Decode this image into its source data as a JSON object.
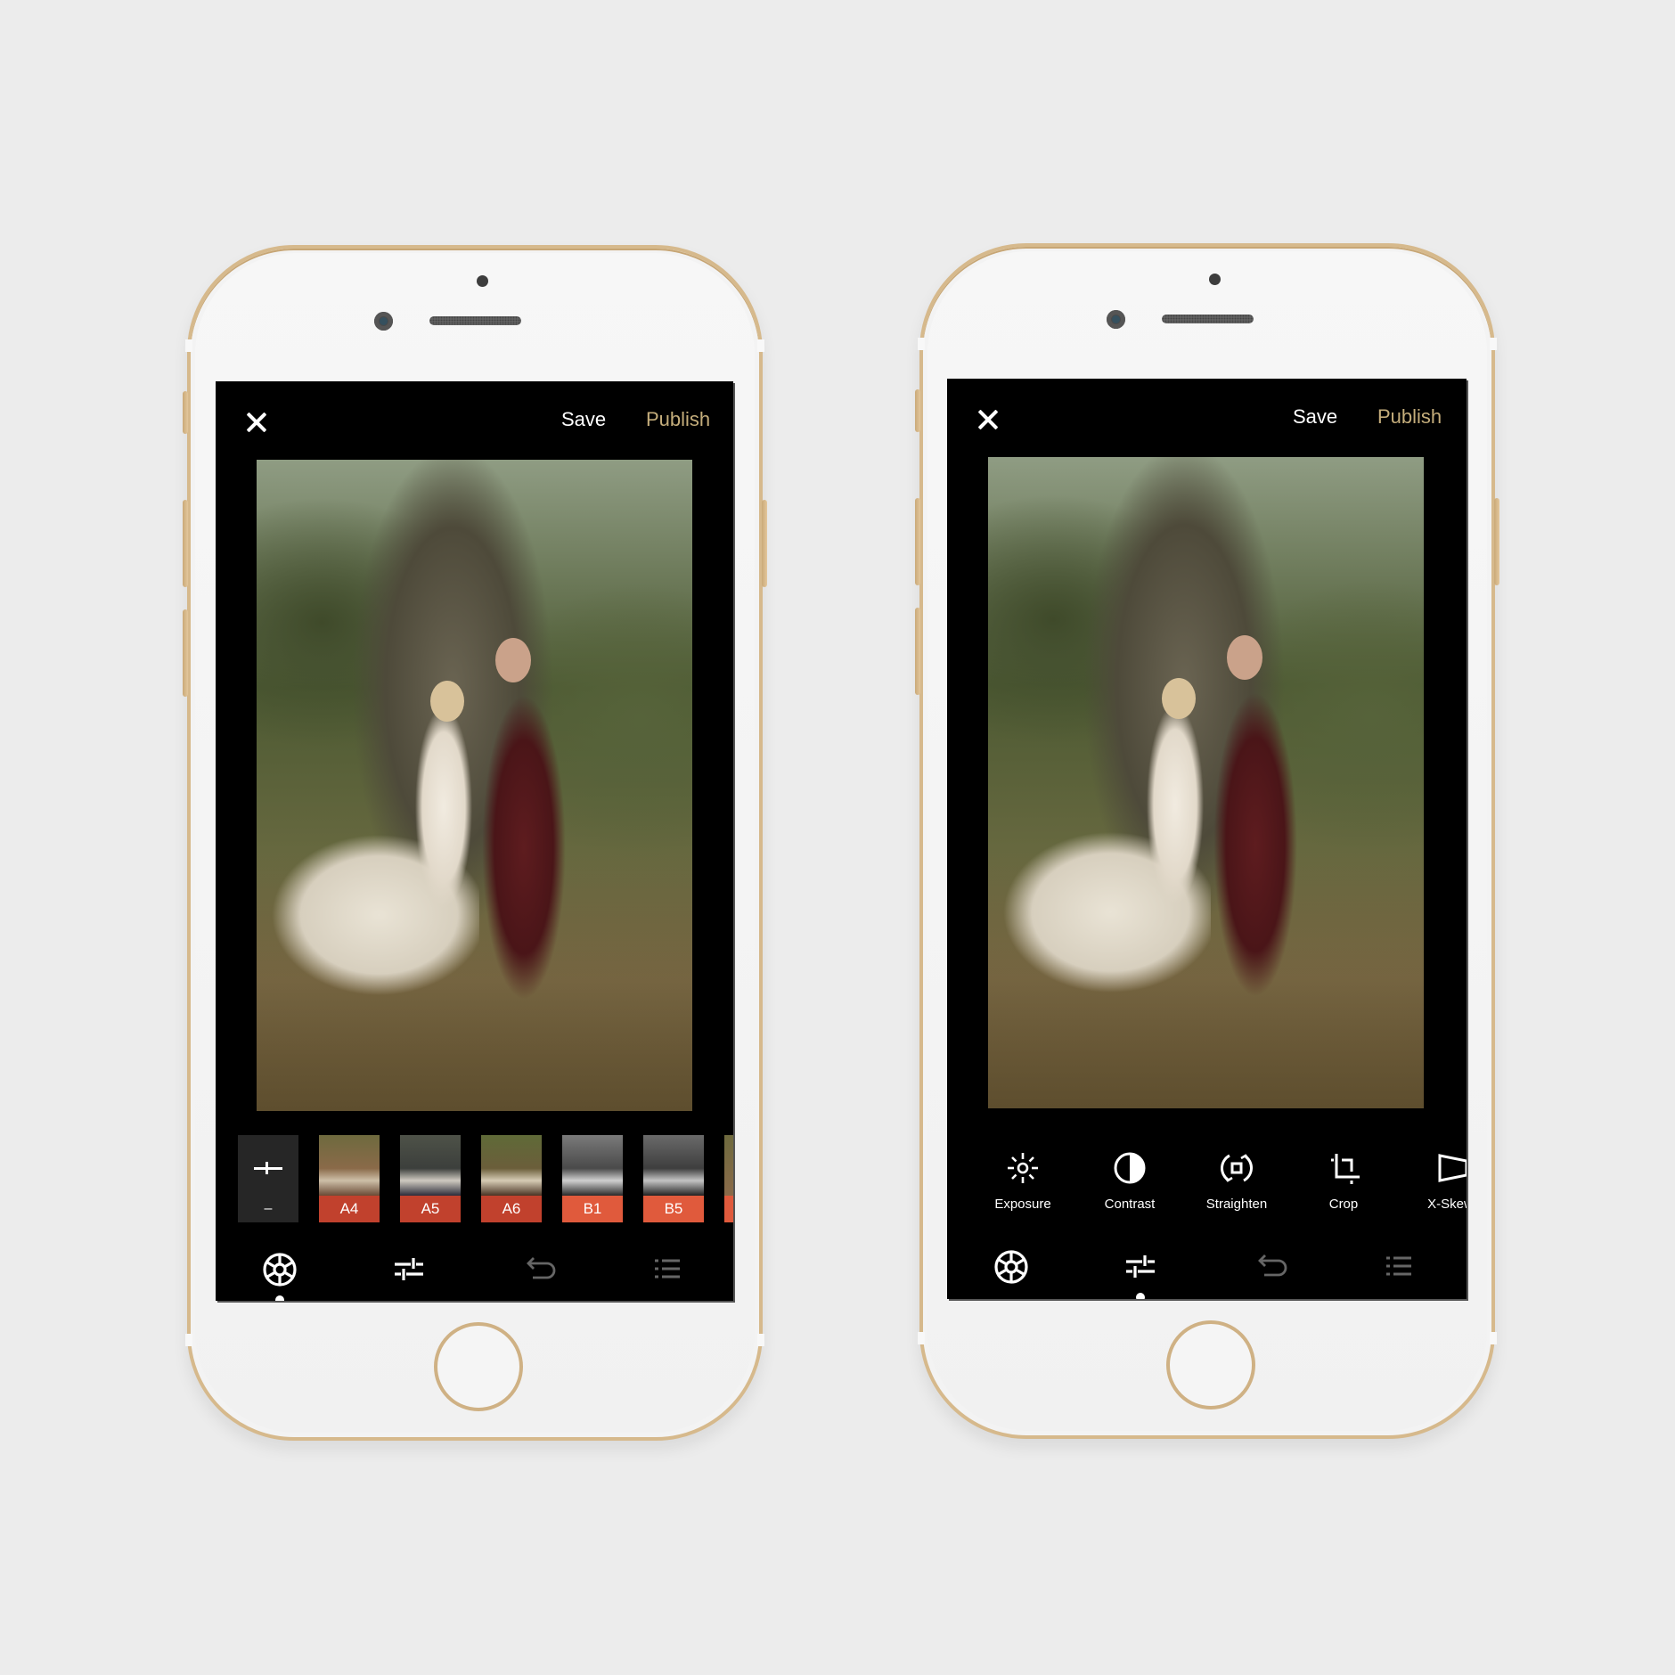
{
  "colors": {
    "background": "#ececec",
    "bezel_gold": "#d6b98c",
    "accent_gold": "#c4ad7b",
    "preset_red_dark": "#c1412d",
    "preset_red_light": "#e05a3c"
  },
  "phones": [
    {
      "id": "left",
      "screen": "presets",
      "header": {
        "close_icon": "close-icon",
        "save_label": "Save",
        "publish_label": "Publish"
      },
      "presets": {
        "tool_dash": "–",
        "items": [
          {
            "label": "A4",
            "style": "warm",
            "label_color": "#c1412d"
          },
          {
            "label": "A5",
            "style": "cool",
            "label_color": "#c1412d"
          },
          {
            "label": "A6",
            "style": "warm",
            "label_color": "#c1412d"
          },
          {
            "label": "B1",
            "style": "bw",
            "label_color": "#e05a3c"
          },
          {
            "label": "B5",
            "style": "bw",
            "label_color": "#e05a3c"
          }
        ]
      },
      "nav": {
        "active": "presets",
        "items": [
          "presets-wheel-icon",
          "adjust-sliders-icon",
          "undo-icon",
          "history-list-icon"
        ]
      }
    },
    {
      "id": "right",
      "screen": "tools",
      "header": {
        "close_icon": "close-icon",
        "save_label": "Save",
        "publish_label": "Publish"
      },
      "tools": [
        {
          "label": "Exposure",
          "icon": "exposure-icon"
        },
        {
          "label": "Contrast",
          "icon": "contrast-icon"
        },
        {
          "label": "Straighten",
          "icon": "straighten-icon"
        },
        {
          "label": "Crop",
          "icon": "crop-icon"
        },
        {
          "label": "X-Skew",
          "icon": "x-skew-icon"
        }
      ],
      "nav": {
        "active": "tools",
        "items": [
          "presets-wheel-icon",
          "adjust-sliders-icon",
          "undo-icon",
          "history-list-icon"
        ]
      }
    }
  ]
}
